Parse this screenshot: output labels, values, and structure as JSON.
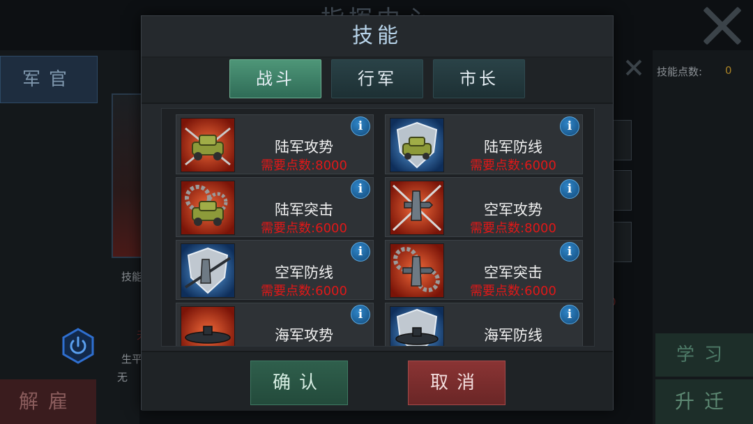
{
  "background": {
    "title": "指挥中心",
    "officer_button": "军官",
    "dismiss_button": "解雇",
    "skill_label": "技能",
    "career_label": "生平",
    "none_text": "无",
    "small_red_text": "无",
    "skill_points_label": "技能点数:",
    "skill_points_value": "0",
    "learn_button": "学习",
    "promote_button": "升迁",
    "mid_red_text": "0"
  },
  "modal": {
    "title": "技能",
    "tabs": [
      {
        "label": "战斗",
        "active": true
      },
      {
        "label": "行军",
        "active": false
      },
      {
        "label": "市长",
        "active": false
      }
    ],
    "skills": [
      {
        "name": "陆军攻势",
        "cost": "需要点数:8000",
        "icon": "tank-attack-icon"
      },
      {
        "name": "陆军防线",
        "cost": "需要点数:6000",
        "icon": "tank-defense-icon"
      },
      {
        "name": "陆军突击",
        "cost": "需要点数:6000",
        "icon": "tank-assault-icon"
      },
      {
        "name": "空军攻势",
        "cost": "需要点数:8000",
        "icon": "plane-attack-icon"
      },
      {
        "name": "空军防线",
        "cost": "需要点数:6000",
        "icon": "plane-defense-icon"
      },
      {
        "name": "空军突击",
        "cost": "需要点数:6000",
        "icon": "plane-assault-icon"
      },
      {
        "name": "海军攻势",
        "cost": "",
        "icon": "submarine-attack-icon"
      },
      {
        "name": "海军防线",
        "cost": "",
        "icon": "submarine-defense-icon"
      }
    ],
    "info_glyph": "i",
    "confirm_button": "确认",
    "cancel_button": "取消"
  },
  "colors": {
    "cost_red": "#e01818",
    "tab_active": "#4e9678",
    "confirm_green": "#2f5f4c",
    "cancel_red": "#8a3434",
    "info_blue": "#2f86c9",
    "title_blue": "#b8d4ea"
  }
}
